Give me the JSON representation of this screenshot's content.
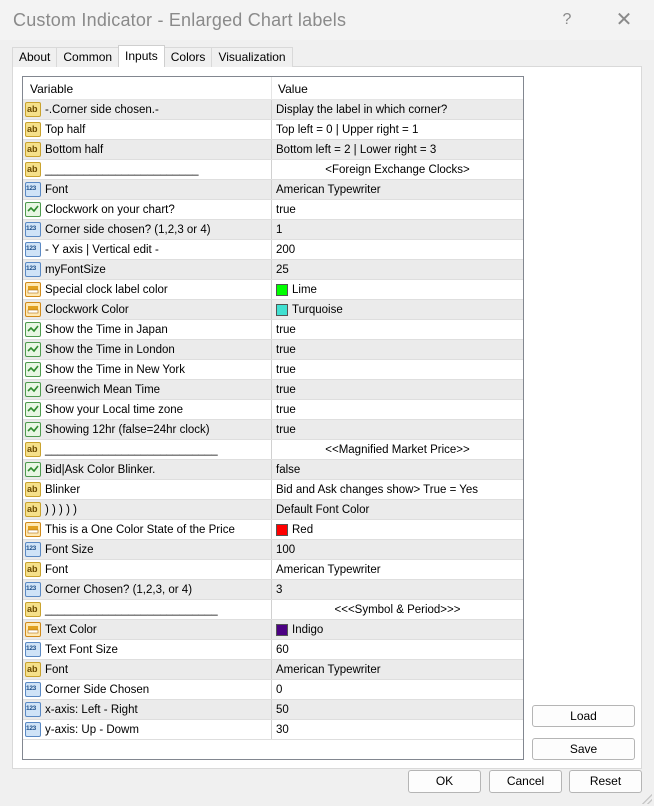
{
  "window": {
    "title": "Custom Indicator - Enlarged Chart labels",
    "help_label": "?",
    "close_label": "✕"
  },
  "tabs": [
    {
      "label": "About",
      "active": false
    },
    {
      "label": "Common",
      "active": false
    },
    {
      "label": "Inputs",
      "active": true
    },
    {
      "label": "Colors",
      "active": false
    },
    {
      "label": "Visualization",
      "active": false
    }
  ],
  "grid": {
    "headers": {
      "variable": "Variable",
      "value": "Value"
    },
    "rows": [
      {
        "type": "ab",
        "variable": "-.Corner side chosen.-",
        "value": "Display the label in which corner?"
      },
      {
        "type": "ab",
        "variable": "Top half",
        "value": "Top left = 0  |  Upper right = 1"
      },
      {
        "type": "ab",
        "variable": "Bottom  half",
        "value": "Bottom left = 2  |  Lower right = 3"
      },
      {
        "type": "ab",
        "variable": "________________________",
        "value": "<Foreign Exchange Clocks>",
        "center": true
      },
      {
        "type": "num",
        "variable": "Font",
        "value": "American Typewriter"
      },
      {
        "type": "bool",
        "variable": "Clockwork on your chart?",
        "value": "true"
      },
      {
        "type": "num",
        "variable": "Corner side chosen? (1,2,3 or 4)",
        "value": "1"
      },
      {
        "type": "num",
        "variable": "- Y axis | Vertical edit  -",
        "value": "200"
      },
      {
        "type": "num",
        "variable": "myFontSize",
        "value": "25"
      },
      {
        "type": "color",
        "variable": "Special clock label color",
        "value": "Lime",
        "color": "#00ff00"
      },
      {
        "type": "color",
        "variable": "Clockwork Color",
        "value": "Turquoise",
        "color": "#40e0d0"
      },
      {
        "type": "bool",
        "variable": "Show the Time in Japan",
        "value": "true"
      },
      {
        "type": "bool",
        "variable": "Show the Time in London",
        "value": "true"
      },
      {
        "type": "bool",
        "variable": "Show the Time in New York",
        "value": "true"
      },
      {
        "type": "bool",
        "variable": "Greenwich Mean Time",
        "value": "true"
      },
      {
        "type": "bool",
        "variable": "Show your Local time zone",
        "value": "true"
      },
      {
        "type": "bool",
        "variable": "Showing 12hr (false=24hr clock)",
        "value": "true"
      },
      {
        "type": "ab",
        "variable": "___________________________",
        "value": "<<Magnified Market Price>>",
        "center": true
      },
      {
        "type": "bool",
        "variable": "Bid|Ask Color Blinker.",
        "value": "false"
      },
      {
        "type": "ab",
        "variable": "Blinker",
        "value": "Bid and Ask changes show> True = Yes"
      },
      {
        "type": "ab",
        "variable": ") ) ) )   )",
        "value": "Default Font Color"
      },
      {
        "type": "color",
        "variable": "This is a One Color State of the Price",
        "value": "Red",
        "color": "#ff0000"
      },
      {
        "type": "num",
        "variable": "Font Size",
        "value": "100"
      },
      {
        "type": "ab",
        "variable": "Font",
        "value": "American Typewriter"
      },
      {
        "type": "num",
        "variable": "Corner Chosen? (1,2,3, or 4)",
        "value": "3"
      },
      {
        "type": "ab",
        "variable": "___________________________",
        "value": "<<<Symbol & Period>>>",
        "center": true
      },
      {
        "type": "color",
        "variable": "Text Color",
        "value": "Indigo",
        "color": "#4b0082"
      },
      {
        "type": "num",
        "variable": "Text Font Size",
        "value": "60"
      },
      {
        "type": "ab",
        "variable": "Font",
        "value": "American Typewriter"
      },
      {
        "type": "num",
        "variable": "Corner Side Chosen",
        "value": "0"
      },
      {
        "type": "num",
        "variable": "x-axis: Left - Right",
        "value": "50"
      },
      {
        "type": "num",
        "variable": "y-axis: Up - Dowm",
        "value": "30"
      }
    ]
  },
  "buttons": {
    "load": "Load",
    "save": "Save",
    "ok": "OK",
    "cancel": "Cancel",
    "reset": "Reset"
  }
}
